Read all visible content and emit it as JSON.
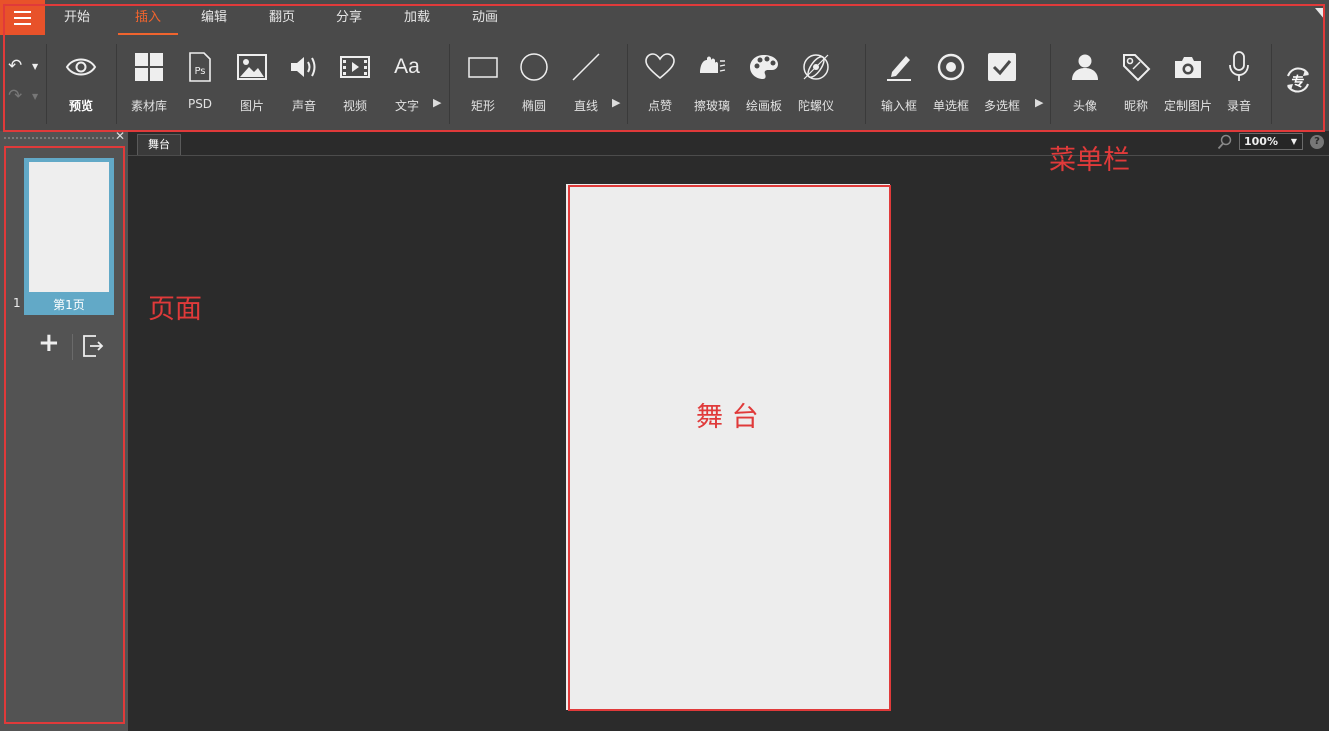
{
  "menu_button": {
    "icon": "hamburger-icon"
  },
  "tabs": [
    {
      "label": "开始",
      "active": false
    },
    {
      "label": "插入",
      "active": true
    },
    {
      "label": "编辑",
      "active": false
    },
    {
      "label": "翻页",
      "active": false
    },
    {
      "label": "分享",
      "active": false
    },
    {
      "label": "加载",
      "active": false
    },
    {
      "label": "动画",
      "active": false
    }
  ],
  "ribbon": {
    "preview": {
      "label": "预览",
      "icon": "eye-icon"
    },
    "tools": [
      {
        "label": "素材库",
        "icon": "grid-icon"
      },
      {
        "label": "PSD",
        "icon": "psd-file-icon"
      },
      {
        "label": "图片",
        "icon": "image-icon"
      },
      {
        "label": "声音",
        "icon": "speaker-icon"
      },
      {
        "label": "视频",
        "icon": "film-icon"
      },
      {
        "label": "文字",
        "icon": "text-aa-icon"
      },
      {
        "label": "矩形",
        "icon": "rectangle-icon"
      },
      {
        "label": "椭圆",
        "icon": "ellipse-icon"
      },
      {
        "label": "直线",
        "icon": "line-icon"
      },
      {
        "label": "点赞",
        "icon": "heart-icon"
      },
      {
        "label": "擦玻璃",
        "icon": "wipe-hand-icon"
      },
      {
        "label": "绘画板",
        "icon": "palette-icon"
      },
      {
        "label": "陀螺仪",
        "icon": "gyroscope-icon"
      },
      {
        "label": "输入框",
        "icon": "pen-icon"
      },
      {
        "label": "单选框",
        "icon": "radio-icon"
      },
      {
        "label": "多选框",
        "icon": "checkbox-icon"
      },
      {
        "label": "头像",
        "icon": "person-icon"
      },
      {
        "label": "昵称",
        "icon": "tag-icon"
      },
      {
        "label": "定制图片",
        "icon": "camera-icon"
      },
      {
        "label": "录音",
        "icon": "microphone-icon"
      }
    ],
    "pro_icon_text": "专"
  },
  "pages": {
    "items": [
      {
        "number": "1",
        "label": "第1页"
      }
    ]
  },
  "stage": {
    "tab_label": "舞台",
    "zoom": "100%",
    "help": "?"
  },
  "annotations": {
    "menubar": "菜单栏",
    "pages": "页面",
    "stage": "舞 台"
  },
  "colors": {
    "accent": "#f0642e",
    "annotation_red": "#e03a3a",
    "page_selected": "#62a9c7"
  }
}
